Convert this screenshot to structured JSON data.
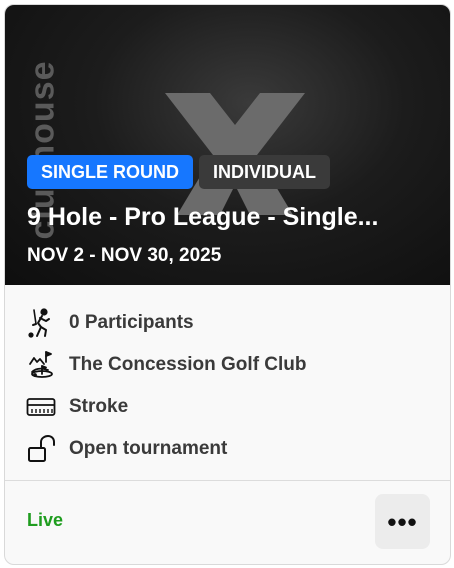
{
  "hero": {
    "brand_text": "clubhouse",
    "badges": [
      {
        "label": "SINGLE ROUND"
      },
      {
        "label": "INDIVIDUAL"
      }
    ],
    "title": "9 Hole - Pro League - Single...",
    "dates": "NOV 2 - NOV 30, 2025"
  },
  "details": [
    {
      "icon": "golfer-icon",
      "text": "0 Participants"
    },
    {
      "icon": "golf-course-icon",
      "text": "The Concession Golf Club"
    },
    {
      "icon": "scorecard-icon",
      "text": "Stroke"
    },
    {
      "icon": "unlock-icon",
      "text": "Open tournament"
    }
  ],
  "footer": {
    "status": "Live",
    "more_label": "•••"
  },
  "colors": {
    "accent": "#1677ff",
    "status_live": "#1f9d1f",
    "badge_secondary": "#3a3a3a"
  }
}
